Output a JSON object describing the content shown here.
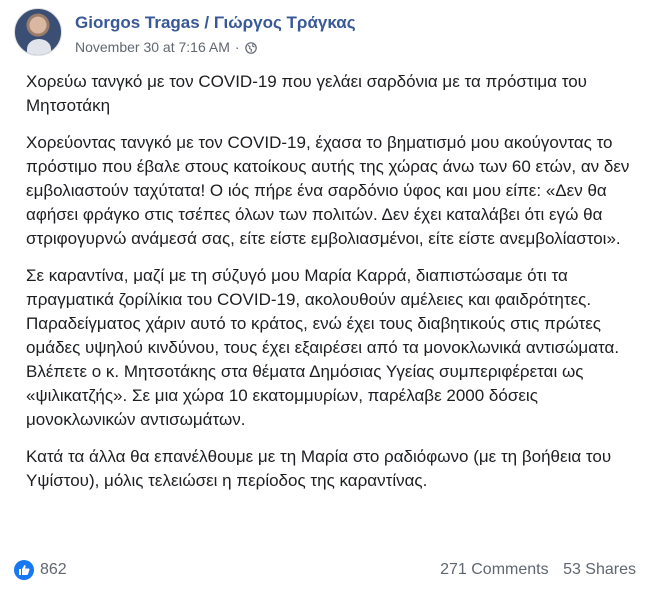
{
  "post": {
    "author": "Giorgos Tragas / Γιώργος Τράγκας",
    "timestamp": "November 30 at 7:16 AM",
    "separator": "·",
    "privacy_icon": "globe-icon",
    "paragraphs": [
      "Χορεύω τανγκό με τον COVID-19 που γελάει σαρδόνια με τα πρόστιμα του Μητσοτάκη",
      "Χορεύοντας τανγκό με τον COVID-19, έχασα το βηματισμό μου ακούγοντας το πρόστιμο που έβαλε στους κατοίκους αυτής της χώρας άνω των 60 ετών, αν δεν εμβολιαστούν ταχύτατα! Ο ιός πήρε ένα σαρδόνιο ύφος και μου είπε: «Δεν θα αφήσει φράγκο στις τσέπες όλων των πολιτών. Δεν έχει καταλάβει ότι εγώ θα στριφογυρνώ ανάμεσά σας, είτε είστε εμβολιασμένοι, είτε είστε ανεμβολίαστοι».",
      "Σε καραντίνα, μαζί με τη σύζυγό μου Μαρία Καρρά, διαπιστώσαμε ότι τα πραγματικά ζορίλίκια του COVID-19, ακολουθούν αμέλειες και φαιδρότητες. Παραδείγματος χάριν αυτό το κράτος, ενώ έχει τους διαβητικούς στις πρώτες ομάδες υψηλού κινδύνου, τους έχει εξαιρέσει από τα μονοκλωνικά αντισώματα. Βλέπετε ο κ. Μητσοτάκης στα θέματα Δημόσιας Υγείας συμπεριφέρεται ως «ψιλικατζής». Σε μια χώρα 10 εκατομμυρίων, παρέλαβε 2000 δόσεις μονοκλωνικών αντισωμάτων.",
      "Κατά τα άλλα θα επανέλθουμε με τη Μαρία στο ραδιόφωνο (με τη βοήθεια του Υψίστου), μόλις τελειώσει η περίοδος της καραντίνας."
    ],
    "reactions_count": "862",
    "comments_label": "271 Comments",
    "shares_label": "53 Shares",
    "accent_color": "#385898",
    "like_color": "#1877f2"
  }
}
